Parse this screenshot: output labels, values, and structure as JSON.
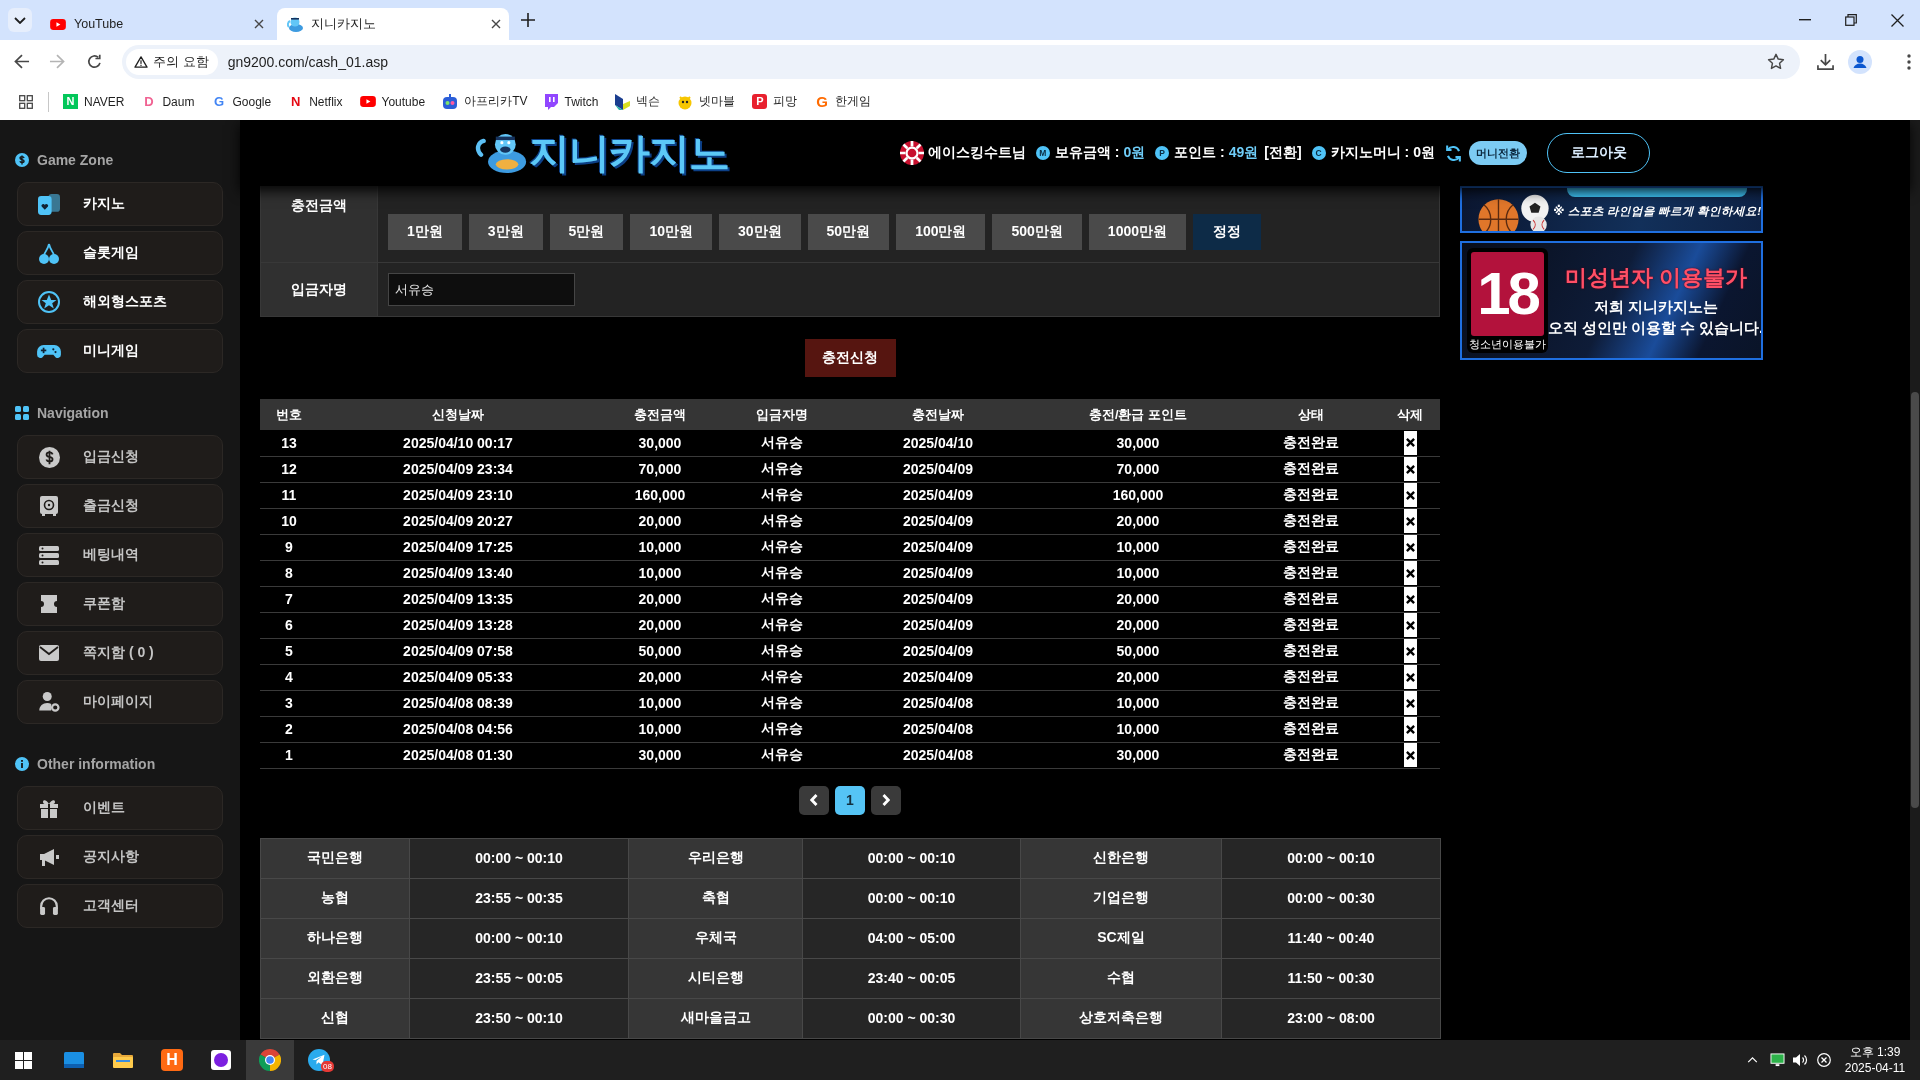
{
  "browser": {
    "tabs": [
      {
        "title": "YouTube",
        "selected": false
      },
      {
        "title": "지니카지노",
        "selected": true
      }
    ],
    "address_bar": {
      "security_label": "주의 요함",
      "url": "gn9200.com/cash_01.asp"
    },
    "bookmarks": [
      {
        "label": "NAVER",
        "glyph": "N"
      },
      {
        "label": "Daum",
        "glyph": "D"
      },
      {
        "label": "Google",
        "glyph": "G"
      },
      {
        "label": "Netflix",
        "glyph": "N"
      },
      {
        "label": "Youtube"
      },
      {
        "label": "아프리카TV"
      },
      {
        "label": "Twitch"
      },
      {
        "label": "넥슨"
      },
      {
        "label": "넷마블"
      },
      {
        "label": "피망",
        "glyph": "P"
      },
      {
        "label": "한게임",
        "glyph": "G"
      }
    ]
  },
  "sidebar": {
    "sections": [
      {
        "title": "Game Zone",
        "kind": "featured",
        "items": [
          "카지노",
          "슬롯게임",
          "해외형스포츠",
          "미니게임"
        ]
      },
      {
        "title": "Navigation",
        "kind": "plain",
        "items": [
          "입금신청",
          "출금신청",
          "베팅내역",
          "쿠폰함",
          "쪽지함 ( 0 )",
          "마이페이지"
        ]
      },
      {
        "title": "Other information",
        "kind": "plain",
        "items": [
          "이벤트",
          "공지사항",
          "고객센터"
        ]
      }
    ]
  },
  "header": {
    "logo_text": "지니카지노",
    "user_name": "에이스킹수트님",
    "balances": [
      {
        "badge": "M",
        "label": "보유금액 :",
        "value": "0원",
        "highlighted": true
      },
      {
        "badge": "P",
        "label": "포인트 :",
        "value": "49원",
        "highlighted": true,
        "action": "[전환]"
      },
      {
        "badge": "C",
        "label": "카지노머니 :",
        "value": "0원",
        "highlighted": false
      }
    ],
    "convert_button": "머니전환",
    "logout_button": "로그아웃"
  },
  "charge_form": {
    "rows": [
      {
        "kind": "amount",
        "label": "충전금액",
        "buttons": [
          "1만원",
          "3만원",
          "5만원",
          "10만원",
          "30만원",
          "50만원",
          "100만원",
          "500만원",
          "1000만원"
        ],
        "reset_button": "정정"
      },
      {
        "kind": "text",
        "label": "입금자명",
        "value": "서유승"
      }
    ],
    "submit_button": "충전신청"
  },
  "history_table": {
    "columns": [
      "번호",
      "신청날짜",
      "충전금액",
      "입금자명",
      "충전날짜",
      "충전/환급 포인트",
      "상태",
      "삭제"
    ],
    "rows": [
      [
        "13",
        "2025/04/10 00:17",
        "30,000",
        "서유승",
        "2025/04/10",
        "30,000",
        "충전완료"
      ],
      [
        "12",
        "2025/04/09 23:34",
        "70,000",
        "서유승",
        "2025/04/09",
        "70,000",
        "충전완료"
      ],
      [
        "11",
        "2025/04/09 23:10",
        "160,000",
        "서유승",
        "2025/04/09",
        "160,000",
        "충전완료"
      ],
      [
        "10",
        "2025/04/09 20:27",
        "20,000",
        "서유승",
        "2025/04/09",
        "20,000",
        "충전완료"
      ],
      [
        "9",
        "2025/04/09 17:25",
        "10,000",
        "서유승",
        "2025/04/09",
        "10,000",
        "충전완료"
      ],
      [
        "8",
        "2025/04/09 13:40",
        "10,000",
        "서유승",
        "2025/04/09",
        "10,000",
        "충전완료"
      ],
      [
        "7",
        "2025/04/09 13:35",
        "20,000",
        "서유승",
        "2025/04/09",
        "20,000",
        "충전완료"
      ],
      [
        "6",
        "2025/04/09 13:28",
        "20,000",
        "서유승",
        "2025/04/09",
        "20,000",
        "충전완료"
      ],
      [
        "5",
        "2025/04/09 07:58",
        "50,000",
        "서유승",
        "2025/04/09",
        "50,000",
        "충전완료"
      ],
      [
        "4",
        "2025/04/09 05:33",
        "20,000",
        "서유승",
        "2025/04/09",
        "20,000",
        "충전완료"
      ],
      [
        "3",
        "2025/04/08 08:39",
        "10,000",
        "서유승",
        "2025/04/08",
        "10,000",
        "충전완료"
      ],
      [
        "2",
        "2025/04/08 04:56",
        "10,000",
        "서유승",
        "2025/04/08",
        "10,000",
        "충전완료"
      ],
      [
        "1",
        "2025/04/08 01:30",
        "30,000",
        "서유승",
        "2025/04/08",
        "30,000",
        "충전완료"
      ]
    ]
  },
  "pagination": {
    "pages": [
      {
        "label": "1",
        "selected": true
      }
    ]
  },
  "bank_hours": {
    "rows": [
      [
        {
          "bank": "국민은행",
          "hours": "00:00 ~ 00:10"
        },
        {
          "bank": "우리은행",
          "hours": "00:00 ~ 00:10"
        },
        {
          "bank": "신한은행",
          "hours": "00:00 ~ 00:10"
        }
      ],
      [
        {
          "bank": "농협",
          "hours": "23:55 ~ 00:35"
        },
        {
          "bank": "축협",
          "hours": "00:00 ~ 00:10"
        },
        {
          "bank": "기업은행",
          "hours": "00:00 ~ 00:30"
        }
      ],
      [
        {
          "bank": "하나은행",
          "hours": "00:00 ~ 00:10"
        },
        {
          "bank": "우체국",
          "hours": "04:00 ~ 05:00"
        },
        {
          "bank": "SC제일",
          "hours": "11:40 ~ 00:40"
        }
      ],
      [
        {
          "bank": "외환은행",
          "hours": "23:55 ~ 00:05"
        },
        {
          "bank": "시티은행",
          "hours": "23:40 ~ 00:05"
        },
        {
          "bank": "수협",
          "hours": "11:50 ~ 00:30"
        }
      ],
      [
        {
          "bank": "신협",
          "hours": "23:50 ~ 00:10"
        },
        {
          "bank": "새마을금고",
          "hours": "00:00 ~ 00:30"
        },
        {
          "bank": "상호저축은행",
          "hours": "23:00 ~ 08:00"
        }
      ]
    ]
  },
  "banners": [
    {
      "kind": "sports",
      "caption": "※ 스포츠 라인업을 빠르게 확인하세요!"
    },
    {
      "kind": "age_limit",
      "badge_number": "18",
      "badge_caption": "청소년이용불가",
      "title": "미성년자 이용불가",
      "lines": [
        "저희 지니카지노는",
        "오직 성인만 이용할 수 있습니다."
      ]
    }
  ],
  "taskbar": {
    "apps": [
      {
        "selected": false
      },
      {
        "selected": false
      },
      {
        "selected": false,
        "glyph": "H"
      },
      {
        "selected": false
      },
      {
        "selected": true
      },
      {
        "selected": false,
        "badge": "08"
      }
    ],
    "clock": {
      "time": "오후 1:39",
      "date": "2025-04-11"
    }
  }
}
